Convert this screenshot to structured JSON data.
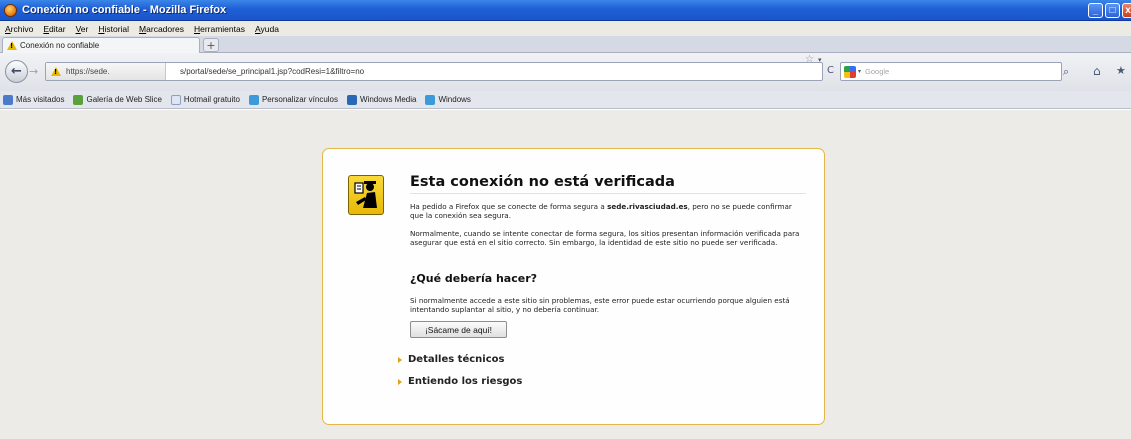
{
  "window": {
    "title": "Conexión no confiable - Mozilla Firefox",
    "minimize_glyph": "_",
    "maximize_glyph": "□",
    "close_glyph": "x"
  },
  "menu": [
    "Archivo",
    "Editar",
    "Ver",
    "Historial",
    "Marcadores",
    "Herramientas",
    "Ayuda"
  ],
  "tab": {
    "label": "Conexión no confiable",
    "new_tab_glyph": "+"
  },
  "navbar": {
    "identity_text": "https://sede.",
    "url_rest": "s/portal/sede/se_principal1.jsp?codResi=1&filtro=no",
    "search_placeholder": "Google",
    "back_glyph": "←",
    "forward_glyph": "→",
    "reload_glyph": "C",
    "star_glyph": "☆",
    "dropdown_glyph": "▾",
    "search_glyph": "⌕",
    "home_glyph": "⌂",
    "bookmarks_glyph": "★"
  },
  "bookmarks": [
    {
      "label": "Más visitados",
      "icon": "most-visited-icon",
      "color": "#4b7ac9"
    },
    {
      "label": "Galería de Web Slice",
      "icon": "web-slice-icon",
      "color": "#5aa03c"
    },
    {
      "label": "Hotmail gratuito",
      "icon": "page-icon",
      "color": "#dfe6f1"
    },
    {
      "label": "Personalizar vínculos",
      "icon": "ie-icon",
      "color": "#3c9ad8"
    },
    {
      "label": "Windows Media",
      "icon": "windows-media-icon",
      "color": "#2868b5"
    },
    {
      "label": "Windows",
      "icon": "ie-icon",
      "color": "#3c9ad8"
    }
  ],
  "error": {
    "title": "Esta conexión no está verificada",
    "para1_pre": "Ha pedido a Firefox que se conecte de forma segura a ",
    "para1_host": "sede.rivasciudad.es",
    "para1_post": ", pero no se puede confirmar que la conexión sea segura.",
    "para2": "Normalmente, cuando se intente conectar de forma segura, los sitios presentan información verificada para asegurar que está en el sitio correcto. Sin embargo, la identidad de este sitio no puede ser verificada.",
    "subhead": "¿Qué debería hacer?",
    "para3": "Si normalmente accede a este sitio sin problemas, este error puede estar ocurriendo porque alguien está intentando suplantar al sitio, y no debería continuar.",
    "get_out_button": "¡Sácame de aquí!",
    "technical_details": "Detalles técnicos",
    "understand_risks": "Entiendo los riesgos"
  },
  "colors": {
    "titlebar": "#1f5fd6",
    "page_bg": "#ecebe7",
    "box_border": "#e3b74a",
    "icon_yellow": "#f0c820",
    "expander": "#e0a11b"
  }
}
